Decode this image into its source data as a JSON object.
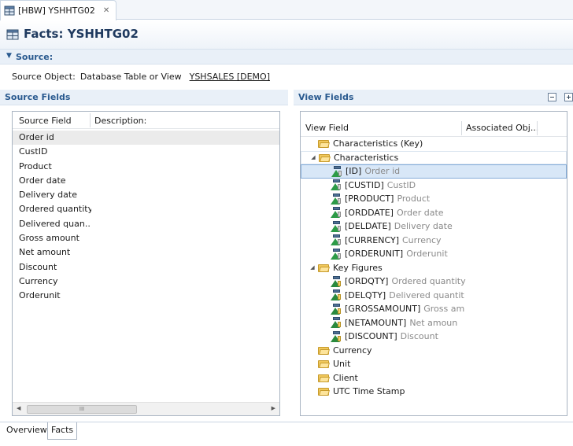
{
  "editor_tab": {
    "label": "[HBW] YSHHTG02",
    "close": "✕",
    "icon": "database-table-icon"
  },
  "header": {
    "title": "Facts: YSHHTG02",
    "icon": "database-table-icon"
  },
  "source_section": {
    "title": "Source:",
    "object_label": "Source Object:",
    "object_type": "Database Table or View",
    "object_link": "YSHSALES [DEMO]"
  },
  "source_fields": {
    "title": "Source Fields",
    "columns": [
      "Source Field",
      "Description:"
    ],
    "rows": [
      "Order id",
      "CustID",
      "Product",
      "Order date",
      "Delivery date",
      "Ordered quantity",
      "Delivered quan...",
      "Gross amount",
      "Net amount",
      "Discount",
      "Currency",
      "Orderunit"
    ],
    "selected_index": 0,
    "scroll_thumb": "III"
  },
  "view_fields": {
    "title": "View Fields",
    "columns": [
      "View Field",
      "Associated Obj..."
    ],
    "tools": [
      "collapse-all-icon",
      "expand-all-icon"
    ],
    "tree": [
      {
        "type": "folder",
        "level": 0,
        "label": "Characteristics (Key)",
        "expanded": false
      },
      {
        "type": "folder",
        "level": 0,
        "label": "Characteristics",
        "expanded": true
      },
      {
        "type": "char",
        "level": 1,
        "name": "[ID]",
        "desc": "Order id",
        "selected": true
      },
      {
        "type": "char",
        "level": 1,
        "name": "[CUSTID]",
        "desc": "CustID"
      },
      {
        "type": "char",
        "level": 1,
        "name": "[PRODUCT]",
        "desc": "Product"
      },
      {
        "type": "char",
        "level": 1,
        "name": "[ORDDATE]",
        "desc": "Order date"
      },
      {
        "type": "char",
        "level": 1,
        "name": "[DELDATE]",
        "desc": "Delivery date"
      },
      {
        "type": "char",
        "level": 1,
        "name": "[CURRENCY]",
        "desc": "Currency"
      },
      {
        "type": "char",
        "level": 1,
        "name": "[ORDERUNIT]",
        "desc": "Orderunit"
      },
      {
        "type": "folder",
        "level": 0,
        "label": "Key Figures",
        "expanded": true
      },
      {
        "type": "kf",
        "level": 1,
        "name": "[ORDQTY]",
        "desc": "Ordered quantity"
      },
      {
        "type": "kf",
        "level": 1,
        "name": "[DELQTY]",
        "desc": "Delivered quantit"
      },
      {
        "type": "kf",
        "level": 1,
        "name": "[GROSSAMOUNT]",
        "desc": "Gross am"
      },
      {
        "type": "kf",
        "level": 1,
        "name": "[NETAMOUNT]",
        "desc": "Net amoun"
      },
      {
        "type": "kf",
        "level": 1,
        "name": "[DISCOUNT]",
        "desc": "Discount"
      },
      {
        "type": "folder",
        "level": 0,
        "label": "Currency",
        "expanded": false
      },
      {
        "type": "folder",
        "level": 0,
        "label": "Unit",
        "expanded": false
      },
      {
        "type": "folder",
        "level": 0,
        "label": "Client",
        "expanded": false
      },
      {
        "type": "folder",
        "level": 0,
        "label": "UTC Time Stamp",
        "expanded": false
      }
    ]
  },
  "bottom_tabs": [
    "Overview",
    "Facts"
  ],
  "colors": {
    "accent": "#2a5a8f",
    "title": "#1f3a5f",
    "selection": "#d8e7f7"
  }
}
